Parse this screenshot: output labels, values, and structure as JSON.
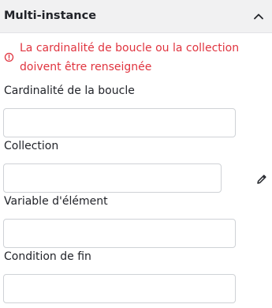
{
  "header": {
    "title": "Multi-instance",
    "toggle_icon": "chevron-up-icon"
  },
  "error": {
    "icon": "warning-circle-icon",
    "line1": "La cardinalité de boucle ou la collection",
    "line2": "doivent être renseignée",
    "color": "#e0343f"
  },
  "fields": {
    "loop_cardinality": {
      "label": "Cardinalité de la boucle",
      "value": ""
    },
    "collection": {
      "label": "Collection",
      "value": "",
      "edit_icon": "pencil-icon"
    },
    "element_variable": {
      "label": "Variable d'élément",
      "value": ""
    },
    "completion_condition": {
      "label": "Condition de fin",
      "value": ""
    }
  }
}
